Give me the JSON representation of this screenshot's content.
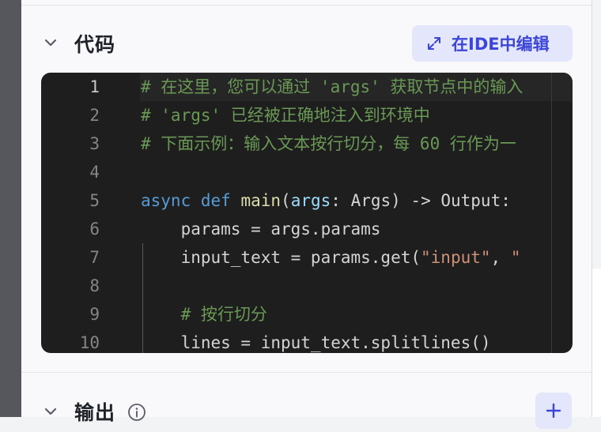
{
  "code_section": {
    "title": "代码",
    "ide_button_label": "在IDE中编辑",
    "lines": [
      {
        "no": "1",
        "tokens": [
          {
            "t": "# 在这里，您可以通过 'args' 获取节点中的输入",
            "c": "c-comment"
          }
        ]
      },
      {
        "no": "2",
        "tokens": [
          {
            "t": "# 'args' 已经被正确地注入到环境中",
            "c": "c-comment"
          }
        ]
      },
      {
        "no": "3",
        "tokens": [
          {
            "t": "# 下面示例：输入文本按行切分，每 60 行作为一",
            "c": "c-comment"
          }
        ]
      },
      {
        "no": "4",
        "tokens": []
      },
      {
        "no": "5",
        "tokens": [
          {
            "t": "async",
            "c": "c-kw"
          },
          {
            "t": " "
          },
          {
            "t": "def",
            "c": "c-kw"
          },
          {
            "t": " "
          },
          {
            "t": "main",
            "c": "c-fn"
          },
          {
            "t": "("
          },
          {
            "t": "args",
            "c": "c-param"
          },
          {
            "t": ": Args) -> Output:"
          }
        ]
      },
      {
        "no": "6",
        "tokens": [
          {
            "t": "    params = args.params"
          }
        ]
      },
      {
        "no": "7",
        "tokens": [
          {
            "t": "    input_text = params.get("
          },
          {
            "t": "\"input\"",
            "c": "c-str"
          },
          {
            "t": ", "
          },
          {
            "t": "\"",
            "c": "c-str"
          }
        ]
      },
      {
        "no": "8",
        "tokens": []
      },
      {
        "no": "9",
        "tokens": [
          {
            "t": "    "
          },
          {
            "t": "# 按行切分",
            "c": "c-comment"
          }
        ]
      },
      {
        "no": "10",
        "tokens": [
          {
            "t": "    lines = input_text.splitlines()"
          }
        ]
      }
    ]
  },
  "output_section": {
    "title": "输出",
    "add_label": "+"
  },
  "icons": {
    "collapse": "chevron-down-icon",
    "expand": "expand-arrows-icon",
    "info": "info-icon",
    "add": "plus-icon"
  },
  "colors": {
    "accent": "#3c46d6",
    "accent_bg": "#e4e6fb",
    "editor_bg": "#1e1e1e",
    "comment": "#6a9955",
    "keyword": "#569cd6",
    "function": "#dcdcaa",
    "string": "#ce9178"
  }
}
